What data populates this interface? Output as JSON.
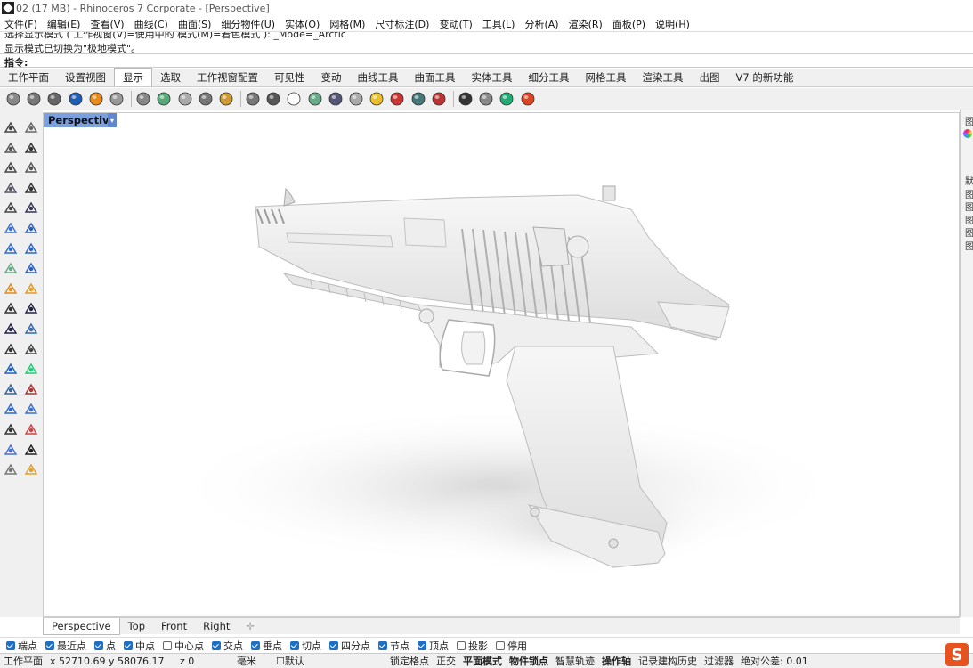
{
  "window": {
    "title": "02 (17 MB) - Rhinoceros 7 Corporate - [Perspective]"
  },
  "menu": [
    "文件(F)",
    "编辑(E)",
    "查看(V)",
    "曲线(C)",
    "曲面(S)",
    "细分物件(U)",
    "实体(O)",
    "网格(M)",
    "尺寸标注(D)",
    "变动(T)",
    "工具(L)",
    "分析(A)",
    "渲染(R)",
    "面板(P)",
    "说明(H)"
  ],
  "command": {
    "history_line1": "选择显示模式 ( 工作视窗(V)=使用中的 模式(M)=着色模式 ): _Mode=_Arctic",
    "history_line2": "显示模式已切换为\"极地模式\"。",
    "prompt": "指令:"
  },
  "tabs": [
    "工作平面",
    "设置视图",
    "显示",
    "选取",
    "工作视窗配置",
    "可见性",
    "变动",
    "曲线工具",
    "曲面工具",
    "实体工具",
    "细分工具",
    "网格工具",
    "渲染工具",
    "出图",
    "V7 的新功能"
  ],
  "active_tab": "显示",
  "toolbar_icons": [
    "wireframe-icon",
    "shaded-icon",
    "rendered-icon",
    "ghosted-icon",
    "xray-icon",
    "technical-icon",
    "artistic-icon",
    "pen-icon",
    "arctic-icon",
    "monochrome-icon",
    "raytraced-icon",
    "render-preview-icon",
    "display-options-icon",
    "shade-selected-icon",
    "color-sphere-icon",
    "environment-icon",
    "light-icon",
    "lock-icon",
    "capture-icon",
    "hide-icon",
    "show-icon",
    "screen-icon",
    "box-icon",
    "layers-icon",
    "palette-icon"
  ],
  "viewport": {
    "label": "Perspective"
  },
  "view_tabs": [
    "Perspective",
    "Top",
    "Front",
    "Right"
  ],
  "active_view_tab": "Perspective",
  "osnaps": [
    {
      "label": "端点",
      "checked": true
    },
    {
      "label": "最近点",
      "checked": true
    },
    {
      "label": "点",
      "checked": true
    },
    {
      "label": "中点",
      "checked": true
    },
    {
      "label": "中心点",
      "checked": false
    },
    {
      "label": "交点",
      "checked": true
    },
    {
      "label": "垂点",
      "checked": true
    },
    {
      "label": "切点",
      "checked": true
    },
    {
      "label": "四分点",
      "checked": true
    },
    {
      "label": "节点",
      "checked": true
    },
    {
      "label": "顶点",
      "checked": true
    },
    {
      "label": "投影",
      "checked": false
    },
    {
      "label": "停用",
      "checked": false
    }
  ],
  "status": {
    "cplane": "工作平面",
    "x": "x 52710.69",
    "y": "y 58076.17",
    "z": "z 0",
    "unit": "毫米",
    "layer": "☐默认",
    "grid_snap": "锁定格点",
    "ortho": "正交",
    "planar": "平面模式",
    "osnap": "物件锁点",
    "smarttrack": "智慧轨迹",
    "gumball": "操作轴",
    "history": "记录建构历史",
    "filter": "过滤器",
    "tolerance": "绝对公差: 0.01"
  },
  "right_panel": {
    "chars": [
      "图",
      "默",
      "图",
      "图",
      "图",
      "图",
      "图"
    ]
  },
  "brand_logo": "S",
  "colors": {
    "viewport_label": "#7aa0e0",
    "checkbox": "#1f6fc5",
    "logo": "#e7531f"
  }
}
